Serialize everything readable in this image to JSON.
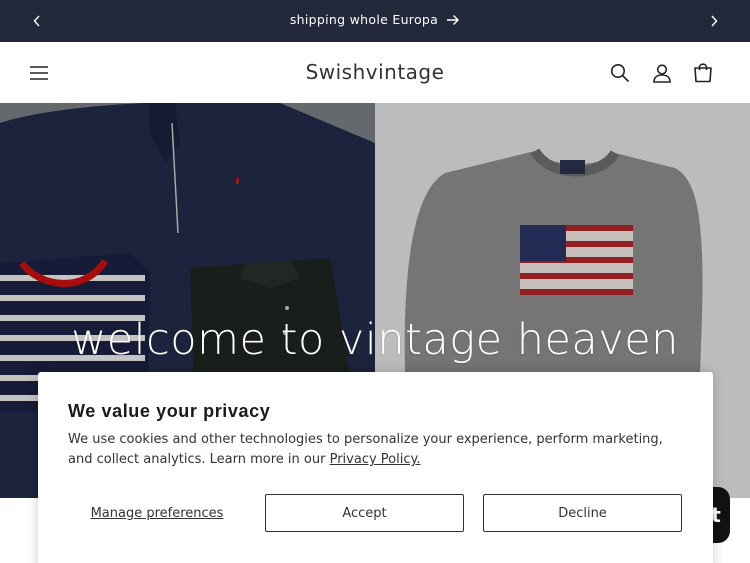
{
  "announcement": {
    "message": "shipping whole Europa",
    "prev_icon": "chevron-left-icon",
    "next_icon": "chevron-right-icon",
    "bg_color": "#23283a"
  },
  "header": {
    "brand": "Swishvintage",
    "icons": [
      "menu-icon",
      "search-icon",
      "account-icon",
      "cart-icon"
    ]
  },
  "hero": {
    "title": "welcome to vintage heaven"
  },
  "cookie_banner": {
    "title": "We value your privacy",
    "body": "We use cookies and other technologies to personalize your experience, perform marketing, and collect analytics. Learn more in our ",
    "link_text": "Privacy Policy.",
    "manage_label": "Manage preferences",
    "accept_label": "Accept",
    "decline_label": "Decline"
  },
  "chat": {
    "glyph": "t"
  }
}
